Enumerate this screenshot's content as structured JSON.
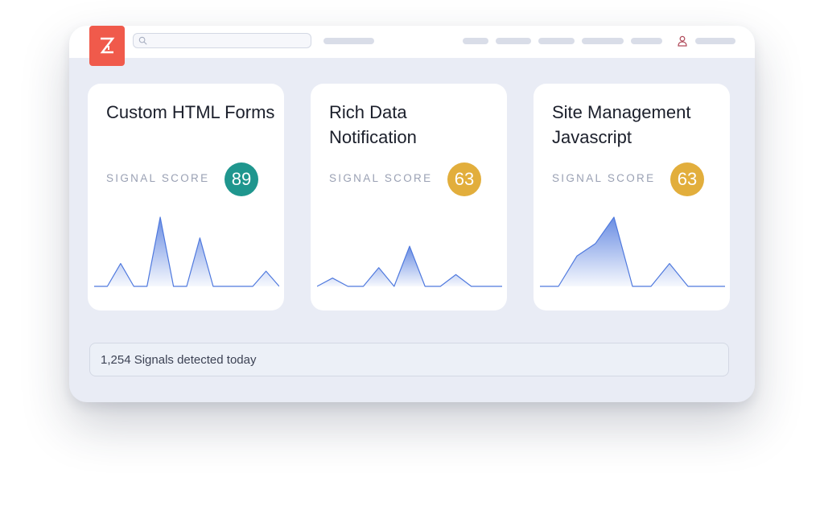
{
  "app": {
    "logo": "Z",
    "logo_icon": "zoominfo-z-logo-icon",
    "search_icon": "search-icon",
    "user_icon": "user-icon"
  },
  "colors": {
    "logo": "#f05a4b",
    "score_high": "#1f968e",
    "score_mid": "#e2ae3c",
    "line": "#4f79de"
  },
  "cards": [
    {
      "title": "Custom HTML Forms",
      "score_label": "SIGNAL SCORE",
      "score": "89",
      "score_color": "#1f968e",
      "spark": [
        0,
        0,
        0.33,
        0,
        0,
        1,
        0,
        0,
        0.7,
        0,
        0,
        0,
        0,
        0.22,
        0
      ]
    },
    {
      "title": "Rich Data Notification",
      "score_label": "SIGNAL SCORE",
      "score": "63",
      "score_color": "#e2ae3c",
      "spark": [
        0,
        0.12,
        0,
        0,
        0.27,
        0,
        0.58,
        0,
        0,
        0.17,
        0,
        0,
        0
      ]
    },
    {
      "title": "Site Management Javascript",
      "score_label": "SIGNAL SCORE",
      "score": "63",
      "score_color": "#e2ae3c",
      "spark": [
        0,
        0,
        0.44,
        0.62,
        1,
        0,
        0,
        0.33,
        0,
        0,
        0
      ]
    }
  ],
  "footer": {
    "signals_text": "1,254 Signals detected today"
  }
}
